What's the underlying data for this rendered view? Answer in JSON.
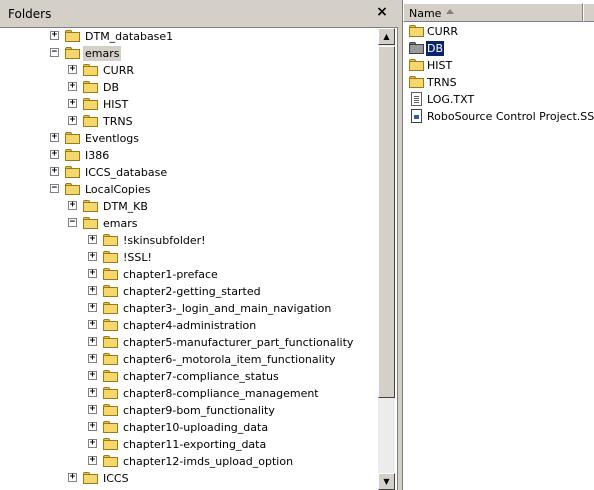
{
  "folders_pane": {
    "title": "Folders",
    "close_glyph": "×"
  },
  "tree": [
    {
      "label": "DTM_database1",
      "expander": "+",
      "level": 1,
      "icon": "folder-icon"
    },
    {
      "label": "emars",
      "expander": "−",
      "level": 1,
      "icon": "folder-icon",
      "state": "highlighted"
    },
    {
      "label": "CURR",
      "expander": "+",
      "level": 2,
      "icon": "folder-icon"
    },
    {
      "label": "DB",
      "expander": "+",
      "level": 2,
      "icon": "folder-icon"
    },
    {
      "label": "HIST",
      "expander": "+",
      "level": 2,
      "icon": "folder-icon"
    },
    {
      "label": "TRNS",
      "expander": "+",
      "level": 2,
      "icon": "folder-icon"
    },
    {
      "label": "Eventlogs",
      "expander": "+",
      "level": 1,
      "icon": "folder-icon"
    },
    {
      "label": "I386",
      "expander": "+",
      "level": 1,
      "icon": "folder-icon"
    },
    {
      "label": "ICCS_database",
      "expander": "+",
      "level": 1,
      "icon": "folder-icon"
    },
    {
      "label": "LocalCopies",
      "expander": "−",
      "level": 1,
      "icon": "folder-icon"
    },
    {
      "label": "DTM_KB",
      "expander": "+",
      "level": 2,
      "icon": "folder-icon"
    },
    {
      "label": "emars",
      "expander": "−",
      "level": 2,
      "icon": "folder-icon"
    },
    {
      "label": "!skinsubfolder!",
      "expander": "+",
      "level": 3,
      "icon": "folder-icon"
    },
    {
      "label": "!SSL!",
      "expander": "+",
      "level": 3,
      "icon": "folder-icon"
    },
    {
      "label": "chapter1-preface",
      "expander": "+",
      "level": 3,
      "icon": "folder-icon"
    },
    {
      "label": "chapter2-getting_started",
      "expander": "+",
      "level": 3,
      "icon": "folder-icon"
    },
    {
      "label": "chapter3-_login_and_main_navigation",
      "expander": "+",
      "level": 3,
      "icon": "folder-icon"
    },
    {
      "label": "chapter4-administration",
      "expander": "+",
      "level": 3,
      "icon": "folder-icon"
    },
    {
      "label": "chapter5-manufacturer_part_functionality",
      "expander": "+",
      "level": 3,
      "icon": "folder-icon"
    },
    {
      "label": "chapter6-_motorola_item_functionality",
      "expander": "+",
      "level": 3,
      "icon": "folder-icon"
    },
    {
      "label": "chapter7-compliance_status",
      "expander": "+",
      "level": 3,
      "icon": "folder-icon"
    },
    {
      "label": "chapter8-compliance_management",
      "expander": "+",
      "level": 3,
      "icon": "folder-icon"
    },
    {
      "label": "chapter9-bom_functionality",
      "expander": "+",
      "level": 3,
      "icon": "folder-icon"
    },
    {
      "label": "chapter10-uploading_data",
      "expander": "+",
      "level": 3,
      "icon": "folder-icon"
    },
    {
      "label": "chapter11-exporting_data",
      "expander": "+",
      "level": 3,
      "icon": "folder-icon"
    },
    {
      "label": "chapter12-imds_upload_option",
      "expander": "+",
      "level": 3,
      "icon": "folder-icon"
    },
    {
      "label": "ICCS",
      "expander": "+",
      "level": 2,
      "icon": "folder-icon"
    }
  ],
  "scrollbar": {
    "up_glyph": "▲",
    "down_glyph": "▼"
  },
  "list_pane": {
    "column_name": "Name",
    "sort": "ascending"
  },
  "files": [
    {
      "label": "CURR",
      "icon": "folder-icon"
    },
    {
      "label": "DB",
      "icon": "folder-icon-dark",
      "selected": true
    },
    {
      "label": "HIST",
      "icon": "folder-icon"
    },
    {
      "label": "TRNS",
      "icon": "folder-icon"
    },
    {
      "label": "LOG.TXT",
      "icon": "text-file-icon"
    },
    {
      "label": "RoboSource Control Project.SSP",
      "icon": "ssp-file-icon"
    }
  ],
  "colors": {
    "folder_yellow": "#f4d86b",
    "selection_bg": "#0a246a",
    "chrome": "#d4d0c8"
  }
}
